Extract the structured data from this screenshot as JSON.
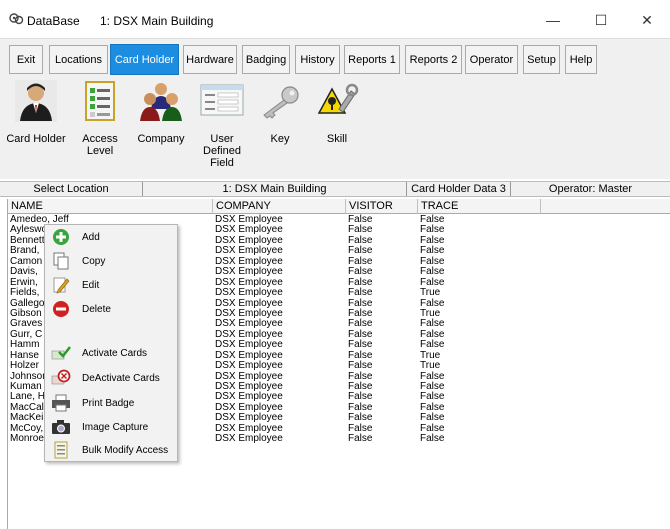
{
  "window": {
    "app_title": "DataBase",
    "location_title": "1: DSX Main Building",
    "minimize_glyph": "—",
    "maximize_glyph": "☐",
    "close_glyph": "✕"
  },
  "tabs": [
    {
      "label": "Exit"
    },
    {
      "label": "Locations"
    },
    {
      "label": "Card Holder",
      "active": true
    },
    {
      "label": "Hardware"
    },
    {
      "label": "Badging"
    },
    {
      "label": "History"
    },
    {
      "label": "Reports 1"
    },
    {
      "label": "Reports 2"
    },
    {
      "label": "Operator"
    },
    {
      "label": "Setup"
    },
    {
      "label": "Help"
    }
  ],
  "toolbar": [
    {
      "label": "Card Holder",
      "icon": "card-holder-icon"
    },
    {
      "label": "Access\nLevel",
      "icon": "access-level-icon"
    },
    {
      "label": "Company",
      "icon": "company-icon"
    },
    {
      "label": "User\nDefined\nField",
      "icon": "user-defined-field-icon"
    },
    {
      "label": "Key",
      "icon": "key-icon"
    },
    {
      "label": "Skill",
      "icon": "skill-icon"
    }
  ],
  "status": {
    "select_location": "Select Location",
    "location": "1: DSX Main Building",
    "record": "Card Holder Data  3",
    "operator": "Operator: Master"
  },
  "columns": [
    "NAME",
    "COMPANY",
    "VISITOR",
    "TRACE"
  ],
  "rows": [
    [
      "Amedeo, Jeff",
      "DSX Employee",
      "False",
      "False"
    ],
    [
      "Aylesworth",
      "DSX Employee",
      "False",
      "False"
    ],
    [
      "Bennett",
      "DSX Employee",
      "False",
      "False"
    ],
    [
      "Brand,",
      "DSX Employee",
      "False",
      "False"
    ],
    [
      "Camon",
      "DSX Employee",
      "False",
      "False"
    ],
    [
      "Davis,",
      "DSX Employee",
      "False",
      "False"
    ],
    [
      "Erwin,",
      "DSX Employee",
      "False",
      "False"
    ],
    [
      "Fields,",
      "DSX Employee",
      "False",
      "True"
    ],
    [
      "Gallegos",
      "DSX Employee",
      "False",
      "False"
    ],
    [
      "Gibson",
      "DSX Employee",
      "False",
      "True"
    ],
    [
      "Graves",
      "DSX Employee",
      "False",
      "False"
    ],
    [
      "Gurr, C",
      "DSX Employee",
      "False",
      "False"
    ],
    [
      "Hamm",
      "DSX Employee",
      "False",
      "False"
    ],
    [
      "Hanse",
      "DSX Employee",
      "False",
      "True"
    ],
    [
      "Holzer",
      "DSX Employee",
      "False",
      "True"
    ],
    [
      "Johnson",
      "DSX Employee",
      "False",
      "False"
    ],
    [
      "Kuman",
      "DSX Employee",
      "False",
      "False"
    ],
    [
      "Lane, Hustee",
      "DSX Employee",
      "False",
      "False"
    ],
    [
      "MacCallum, Bill",
      "DSX Employee",
      "False",
      "False"
    ],
    [
      "MacKeil, John",
      "DSX Employee",
      "False",
      "False"
    ],
    [
      "McCoy, Joshua",
      "DSX Employee",
      "False",
      "False"
    ],
    [
      "Monroe, Bill",
      "DSX Employee",
      "False",
      "False"
    ]
  ],
  "context_menu": [
    {
      "label": "Add",
      "icon": "add-icon"
    },
    {
      "label": "Copy",
      "icon": "copy-icon"
    },
    {
      "label": "Edit",
      "icon": "edit-icon"
    },
    {
      "label": "Delete",
      "icon": "delete-icon"
    },
    {
      "label": "Activate Cards",
      "icon": "activate-cards-icon"
    },
    {
      "label": "DeActivate Cards",
      "icon": "deactivate-cards-icon"
    },
    {
      "label": "Print Badge",
      "icon": "print-badge-icon"
    },
    {
      "label": "Image Capture",
      "icon": "image-capture-icon"
    },
    {
      "label": "Bulk Modify Access",
      "icon": "bulk-modify-access-icon"
    }
  ],
  "colors": {
    "active_tab": "#1c8de0",
    "panel": "#f0f0f0",
    "menu_bg": "#f2f2f2"
  }
}
